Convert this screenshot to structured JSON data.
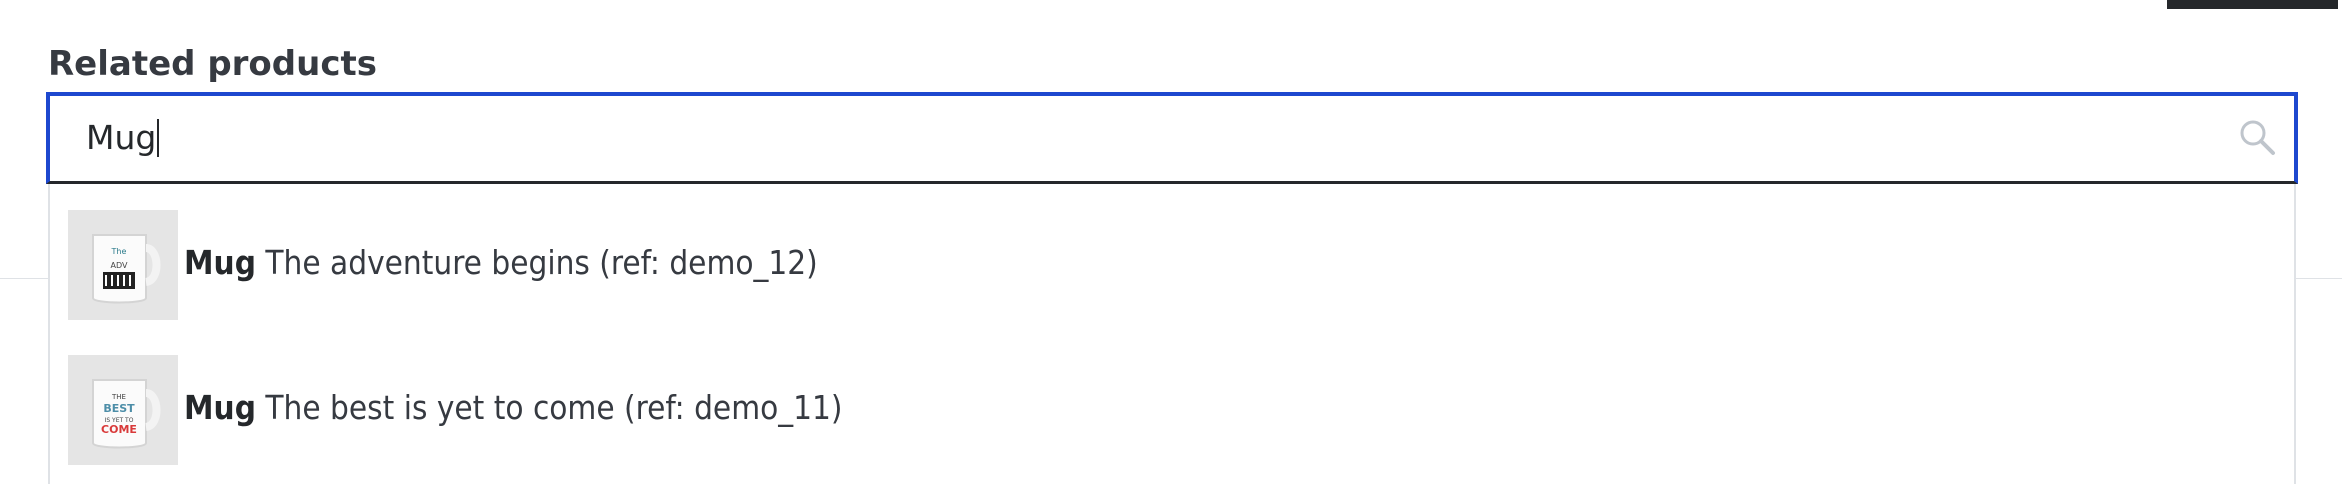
{
  "field": {
    "label": "Related products",
    "search_value": "Mug",
    "search_icon": "search-icon"
  },
  "results": [
    {
      "name": "Mug",
      "description": "The adventure begins (ref: demo_12)",
      "thumbnail_text": "ADVENTURE"
    },
    {
      "name": "Mug",
      "description": "The best is yet to come (ref: demo_11)",
      "thumbnail_text": "BEST COME"
    }
  ],
  "colors": {
    "focus_border": "#1d48cf",
    "text": "#363a41",
    "thumbnail_bg": "#e5e5e5"
  }
}
